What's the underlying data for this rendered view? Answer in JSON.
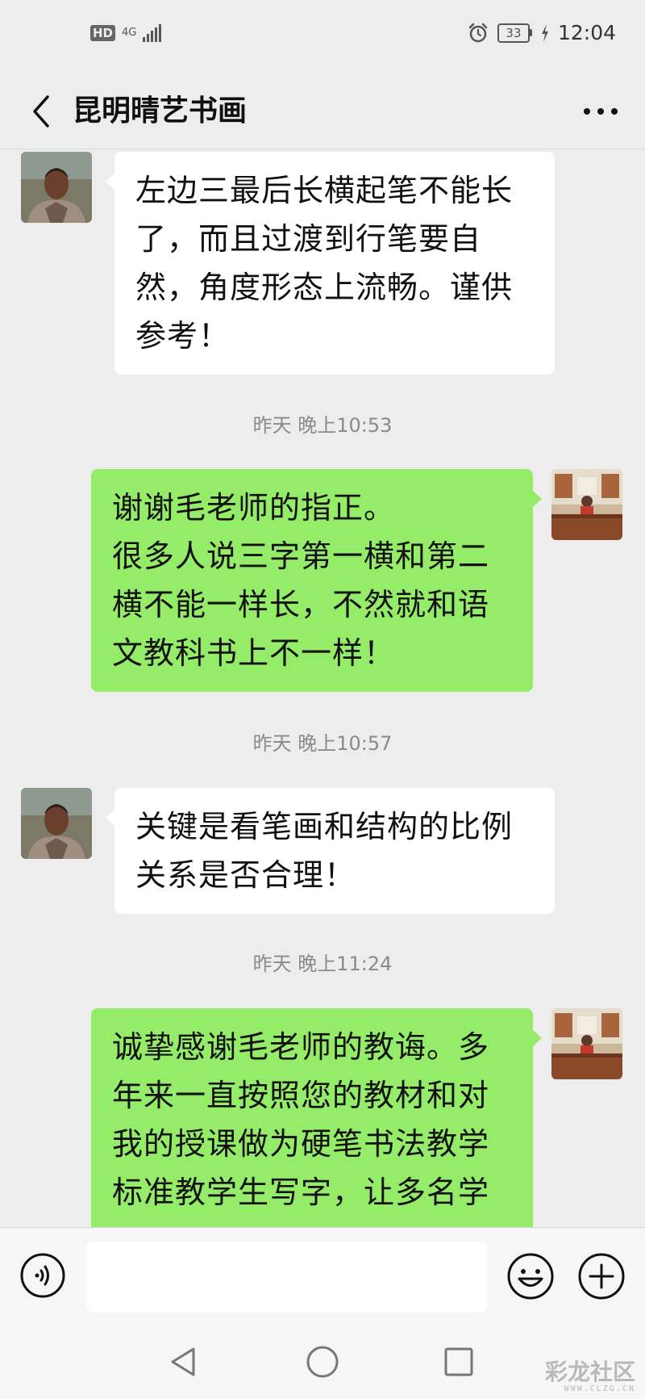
{
  "status_bar": {
    "hd": "HD",
    "network": "4G",
    "battery": "33",
    "time": "12:04",
    "icons": [
      "alarm-icon",
      "charging-icon",
      "signal-icon"
    ]
  },
  "header": {
    "title": "昆明晴艺书画",
    "back_icon": "chevron-left-icon",
    "more_icon": "more-dots-icon"
  },
  "messages": [
    {
      "type": "received",
      "text": "左边三最后长横起笔不能长\n了，而且过渡到行笔要自\n然，角度形态上流畅。谨供\n参考！"
    },
    {
      "type": "timestamp",
      "text": "昨天 晚上10:53"
    },
    {
      "type": "sent",
      "text": "谢谢毛老师的指正。\n很多人说三字第一横和第二\n横不能一样长，不然就和语\n文教科书上不一样！"
    },
    {
      "type": "timestamp",
      "text": "昨天 晚上10:57"
    },
    {
      "type": "received",
      "text": "关键是看笔画和结构的比例\n关系是否合理！"
    },
    {
      "type": "timestamp",
      "text": "昨天 晚上11:24"
    },
    {
      "type": "sent",
      "text": "诚挚感谢毛老师的教诲。多\n年来一直按照您的教材和对\n我的授课做为硬笔书法教学\n标准教学生写字，让多名学"
    }
  ],
  "input_bar": {
    "value": "",
    "voice_icon": "voice-icon",
    "emoji_icon": "emoji-icon",
    "plus_icon": "plus-icon"
  },
  "nav_bar": {
    "icons": [
      "nav-back-icon",
      "nav-home-icon",
      "nav-recent-icon"
    ]
  },
  "watermark": {
    "text": "彩龙社区",
    "sub": "WWW.CLZG.CN"
  },
  "colors": {
    "background": "#ededed",
    "sent_bubble": "#95ec69",
    "received_bubble": "#ffffff",
    "timestamp": "#8a8a8a"
  }
}
